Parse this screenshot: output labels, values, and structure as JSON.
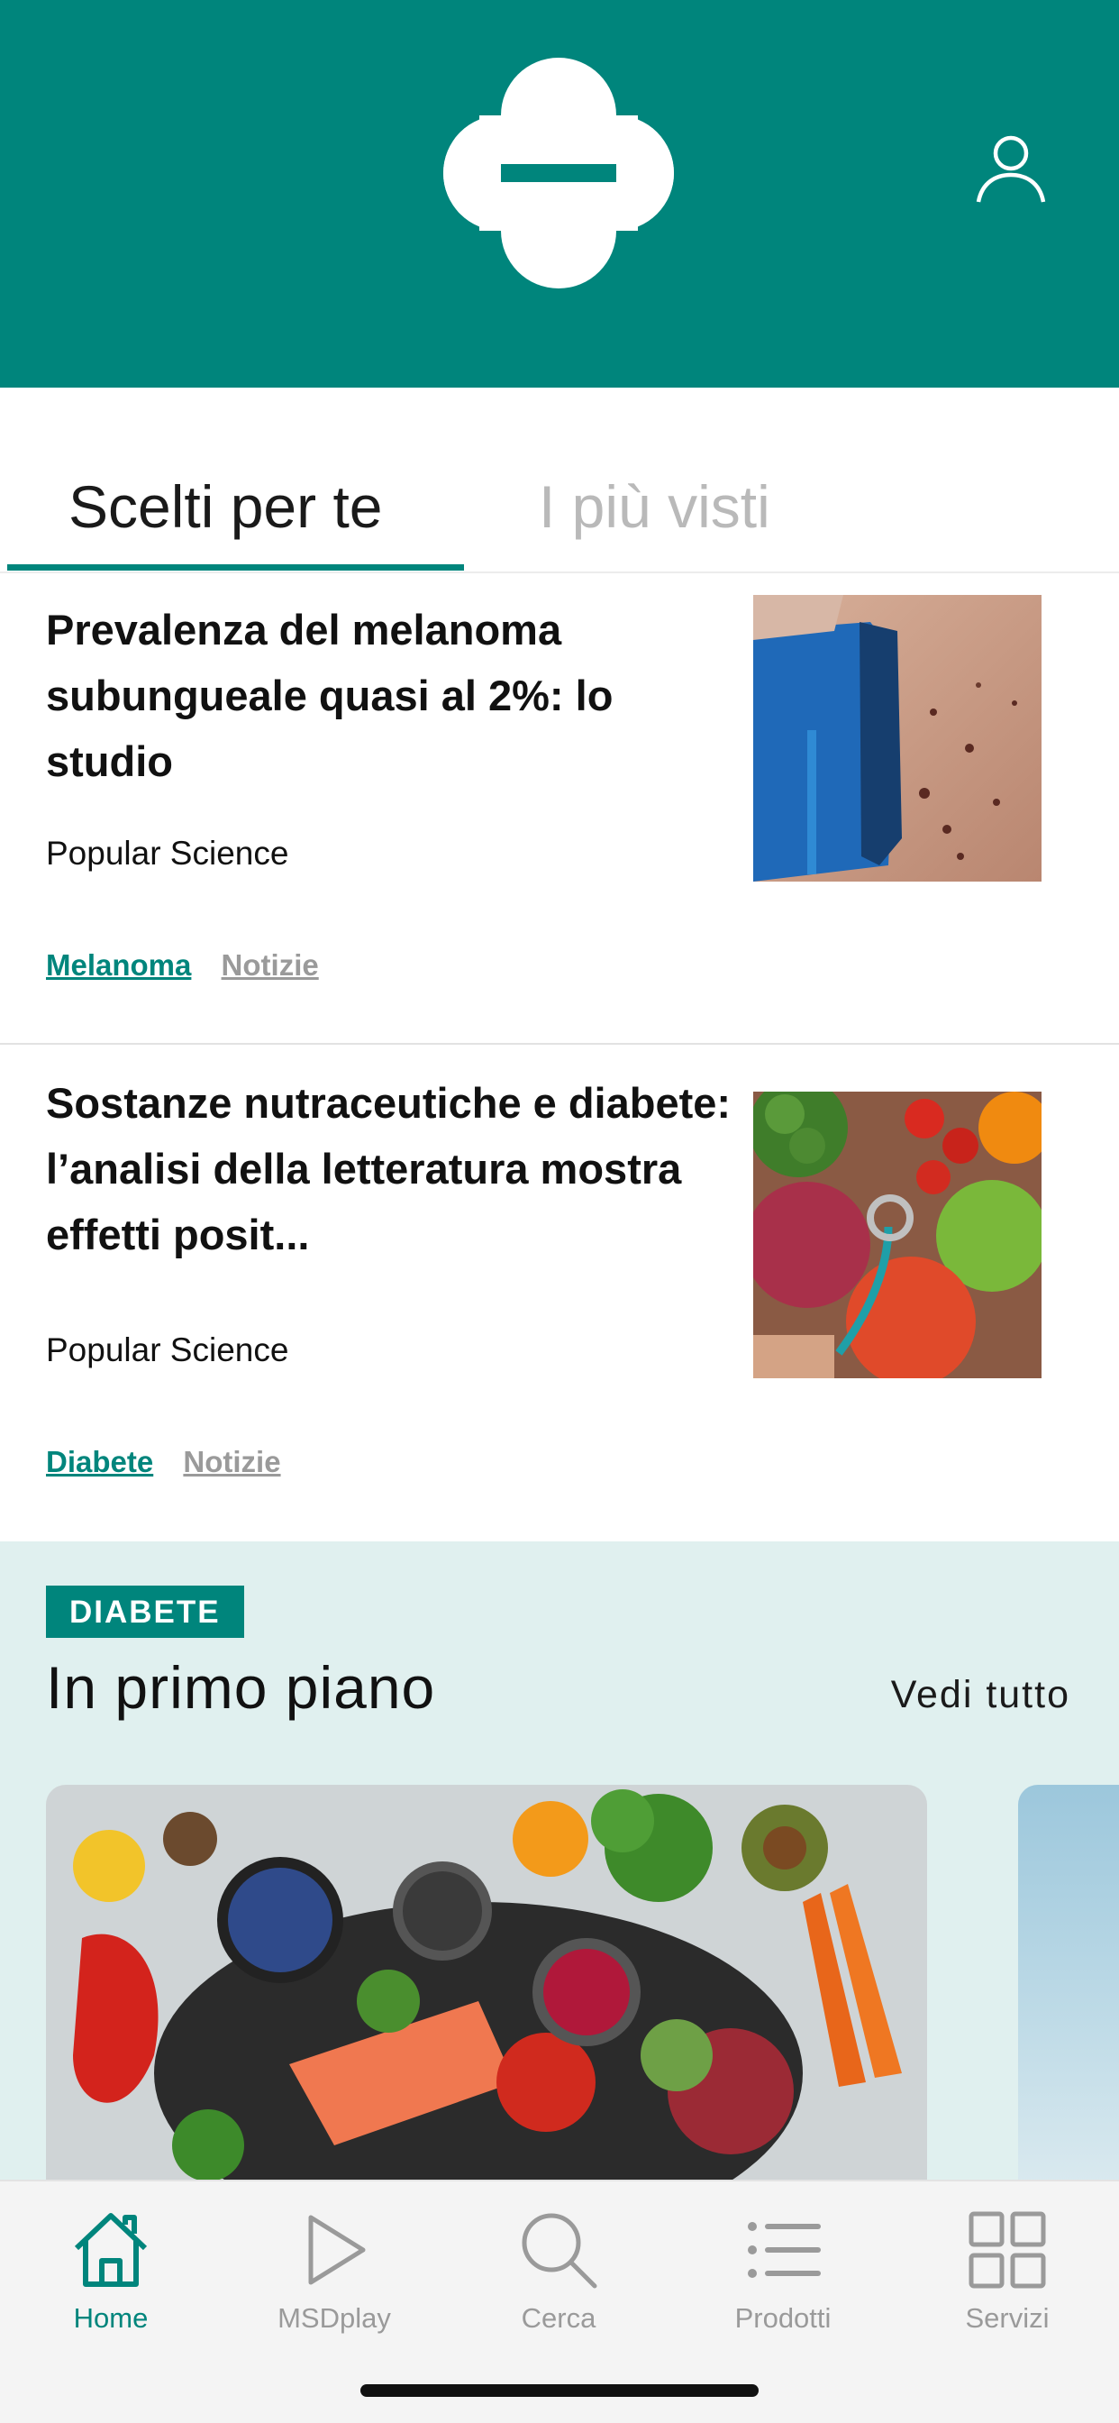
{
  "colors": {
    "brand": "#00857c",
    "featured_bg": "#e0f0ef",
    "muted": "#9a9a9a"
  },
  "header": {
    "logo_icon": "brand-logo-icon",
    "profile_icon": "user-icon"
  },
  "tabs": [
    {
      "label": "Scelti per te",
      "active": true
    },
    {
      "label": "I più visti",
      "active": false
    }
  ],
  "articles": [
    {
      "title": "Prevalenza del melanoma subungueale quasi al 2%: lo studio",
      "source": "Popular Science",
      "tags": [
        "Melanoma",
        "Notizie"
      ]
    },
    {
      "title": "Sostanze nutraceutiche e diabete: l’analisi della letteratura mostra effetti posit...",
      "source": "Popular Science",
      "tags": [
        "Diabete",
        "Notizie"
      ]
    }
  ],
  "featured": {
    "badge": "DIABETE",
    "title": "In primo piano",
    "see_all": "Vedi tutto"
  },
  "nav": [
    {
      "label": "Home",
      "icon": "home-icon",
      "active": true
    },
    {
      "label": "MSDplay",
      "icon": "play-icon",
      "active": false
    },
    {
      "label": "Cerca",
      "icon": "search-icon",
      "active": false
    },
    {
      "label": "Prodotti",
      "icon": "list-icon",
      "active": false
    },
    {
      "label": "Servizi",
      "icon": "grid-icon",
      "active": false
    }
  ]
}
